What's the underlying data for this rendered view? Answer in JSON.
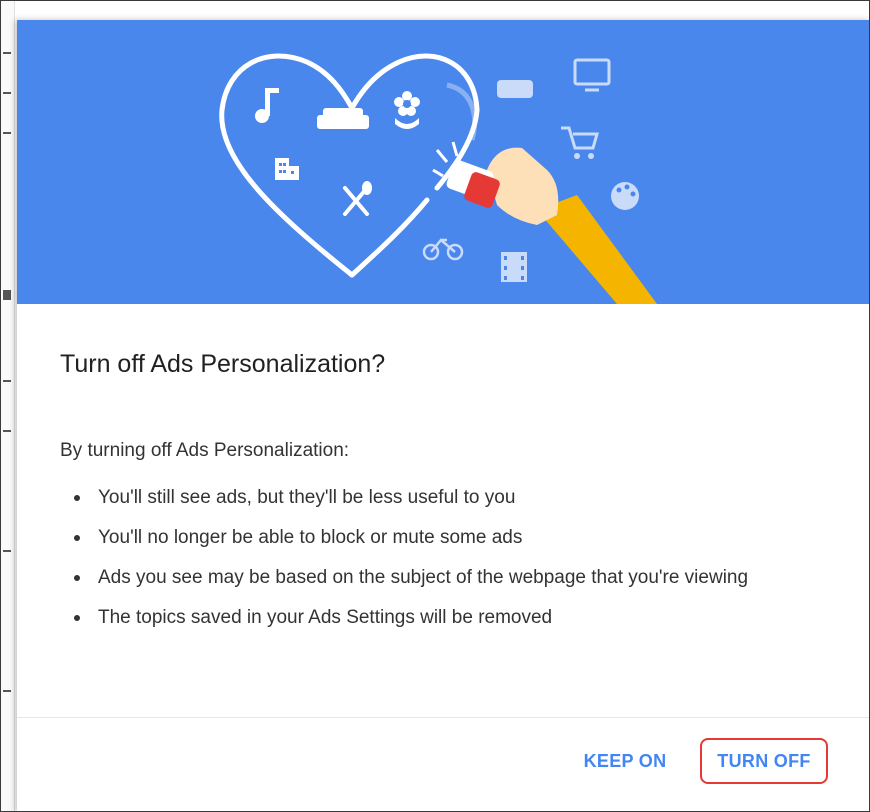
{
  "dialog": {
    "title": "Turn off Ads Personalization?",
    "intro": "By turning off Ads Personalization:",
    "bullets": [
      "You'll still see ads, but they'll be less useful to you",
      "You'll no longer be able to block or mute some ads",
      "Ads you see may be based on the subject of the webpage that you're viewing",
      "The topics saved in your Ads Settings will be removed"
    ],
    "buttons": {
      "keep_on": "KEEP ON",
      "turn_off": "TURN OFF"
    }
  },
  "illustration": {
    "icons": [
      "music-note-icon",
      "sofa-icon",
      "flower-icon",
      "buildings-icon",
      "fork-spoon-icon",
      "gamepad-icon",
      "tv-icon",
      "cart-icon",
      "palette-icon",
      "bicycle-icon",
      "film-icon",
      "hand-eraser-icon"
    ]
  },
  "colors": {
    "hero_blue": "#4a87ec",
    "button_text": "#4285f4",
    "highlight": "#e53935"
  }
}
